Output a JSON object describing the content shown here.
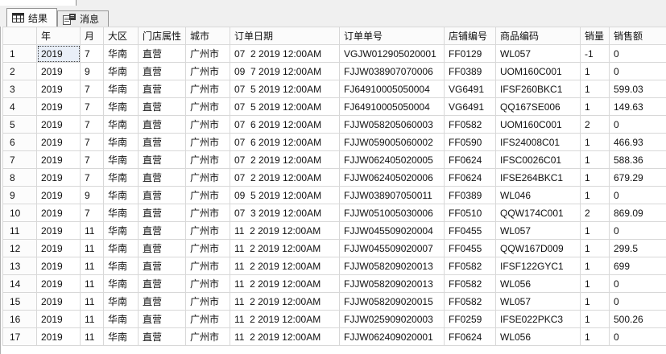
{
  "tabs": [
    {
      "label": "结果",
      "icon": "results-grid-icon"
    },
    {
      "label": "消息",
      "icon": "messages-icon"
    }
  ],
  "grid": {
    "columns": [
      "",
      "年",
      "月",
      "大区",
      "门店属性",
      "城市",
      "订单日期",
      "订单单号",
      "店铺编号",
      "商品编码",
      "销量",
      "销售额"
    ],
    "selected": {
      "row": "1",
      "column": "年"
    },
    "rows": [
      [
        "1",
        "2019",
        "7",
        "华南",
        "直营",
        "广州市",
        "07  2 2019 12:00AM",
        "VGJW012905020001",
        "FF0129",
        "WL057",
        "-1",
        "0"
      ],
      [
        "2",
        "2019",
        "9",
        "华南",
        "直营",
        "广州市",
        "09  7 2019 12:00AM",
        "FJJW038907070006",
        "FF0389",
        "UOM160C001",
        "1",
        "0"
      ],
      [
        "3",
        "2019",
        "7",
        "华南",
        "直营",
        "广州市",
        "07  5 2019 12:00AM",
        "FJ64910005050004",
        "VG6491",
        "IFSF260BKC1",
        "1",
        "599.03"
      ],
      [
        "4",
        "2019",
        "7",
        "华南",
        "直营",
        "广州市",
        "07  5 2019 12:00AM",
        "FJ64910005050004",
        "VG6491",
        "QQ167SE006",
        "1",
        "149.63"
      ],
      [
        "5",
        "2019",
        "7",
        "华南",
        "直营",
        "广州市",
        "07  6 2019 12:00AM",
        "FJJW058205060003",
        "FF0582",
        "UOM160C001",
        "2",
        "0"
      ],
      [
        "6",
        "2019",
        "7",
        "华南",
        "直营",
        "广州市",
        "07  6 2019 12:00AM",
        "FJJW059005060002",
        "FF0590",
        "IFS24008C01",
        "1",
        "466.93"
      ],
      [
        "7",
        "2019",
        "7",
        "华南",
        "直营",
        "广州市",
        "07  2 2019 12:00AM",
        "FJJW062405020005",
        "FF0624",
        "IFSC0026C01",
        "1",
        "588.36"
      ],
      [
        "8",
        "2019",
        "7",
        "华南",
        "直营",
        "广州市",
        "07  2 2019 12:00AM",
        "FJJW062405020006",
        "FF0624",
        "IFSE264BKC1",
        "1",
        "679.29"
      ],
      [
        "9",
        "2019",
        "9",
        "华南",
        "直营",
        "广州市",
        "09  5 2019 12:00AM",
        "FJJW038907050011",
        "FF0389",
        "WL046",
        "1",
        "0"
      ],
      [
        "10",
        "2019",
        "7",
        "华南",
        "直营",
        "广州市",
        "07  3 2019 12:00AM",
        "FJJW051005030006",
        "FF0510",
        "QQW174C001",
        "2",
        "869.09"
      ],
      [
        "11",
        "2019",
        "11",
        "华南",
        "直营",
        "广州市",
        "11  2 2019 12:00AM",
        "FJJW045509020004",
        "FF0455",
        "WL057",
        "1",
        "0"
      ],
      [
        "12",
        "2019",
        "11",
        "华南",
        "直营",
        "广州市",
        "11  2 2019 12:00AM",
        "FJJW045509020007",
        "FF0455",
        "QQW167D009",
        "1",
        "299.5"
      ],
      [
        "13",
        "2019",
        "11",
        "华南",
        "直营",
        "广州市",
        "11  2 2019 12:00AM",
        "FJJW058209020013",
        "FF0582",
        "IFSF122GYC1",
        "1",
        "699"
      ],
      [
        "14",
        "2019",
        "11",
        "华南",
        "直营",
        "广州市",
        "11  2 2019 12:00AM",
        "FJJW058209020013",
        "FF0582",
        "WL056",
        "1",
        "0"
      ],
      [
        "15",
        "2019",
        "11",
        "华南",
        "直营",
        "广州市",
        "11  2 2019 12:00AM",
        "FJJW058209020015",
        "FF0582",
        "WL057",
        "1",
        "0"
      ],
      [
        "16",
        "2019",
        "11",
        "华南",
        "直营",
        "广州市",
        "11  2 2019 12:00AM",
        "FJJW025909020003",
        "FF0259",
        "IFSE022PKC3",
        "1",
        "500.26"
      ],
      [
        "17",
        "2019",
        "11",
        "华南",
        "直营",
        "广州市",
        "11  2 2019 12:00AM",
        "FJJW062409020001",
        "FF0624",
        "WL056",
        "1",
        "0"
      ]
    ]
  },
  "colors": {
    "accent_selected_cell": "#e9eff8",
    "gridline": "#d8d8d8",
    "tab_strip_bg": "#f0f0f0",
    "active_tab_bg": "#fcfcfc"
  }
}
